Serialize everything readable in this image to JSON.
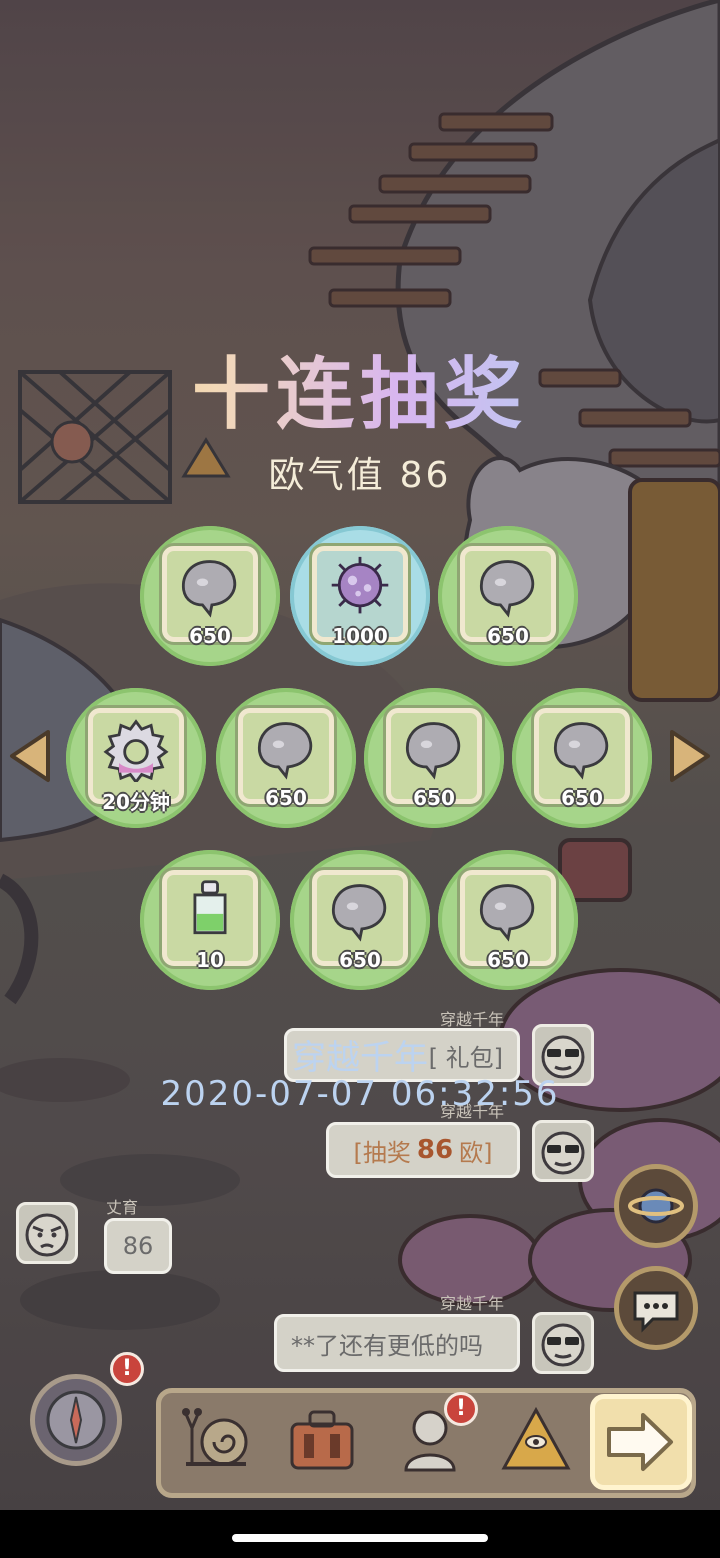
{
  "title": "十连抽奖",
  "luck": {
    "label": "欧气值",
    "value": "86"
  },
  "prizes": [
    {
      "amount": "650",
      "icon": "ghost-icon",
      "rare": false
    },
    {
      "amount": "1000",
      "icon": "virus-icon",
      "rare": true
    },
    {
      "amount": "650",
      "icon": "ghost-icon",
      "rare": false
    },
    {
      "amount": "20分钟",
      "icon": "gear-icon",
      "rare": false
    },
    {
      "amount": "650",
      "icon": "ghost-icon",
      "rare": false
    },
    {
      "amount": "650",
      "icon": "ghost-icon",
      "rare": false
    },
    {
      "amount": "650",
      "icon": "ghost-icon",
      "rare": false
    },
    {
      "amount": "10",
      "icon": "potion-icon",
      "rare": false
    },
    {
      "amount": "650",
      "icon": "ghost-icon",
      "rare": false
    },
    {
      "amount": "650",
      "icon": "ghost-icon",
      "rare": false
    }
  ],
  "chat": {
    "top_name": "穿越千年",
    "msg1": "[    礼包]",
    "msg2_prefix": "[抽奖",
    "msg2_value": "86",
    "msg2_suffix": "欧]",
    "left_name": "丈育",
    "left_msg": "86",
    "bottom_name": "穿越千年",
    "bottom_msg": "**了还有更低的吗"
  },
  "overlay": {
    "name": "穿越千年",
    "time": "2020-07-07 06:32:56"
  },
  "badges": {
    "compass": "!",
    "bust": "!"
  },
  "colors": {
    "ring_green": "#a6d58a",
    "ring_blue": "#a9dde6",
    "title_gradient": "#d8b6ef"
  }
}
